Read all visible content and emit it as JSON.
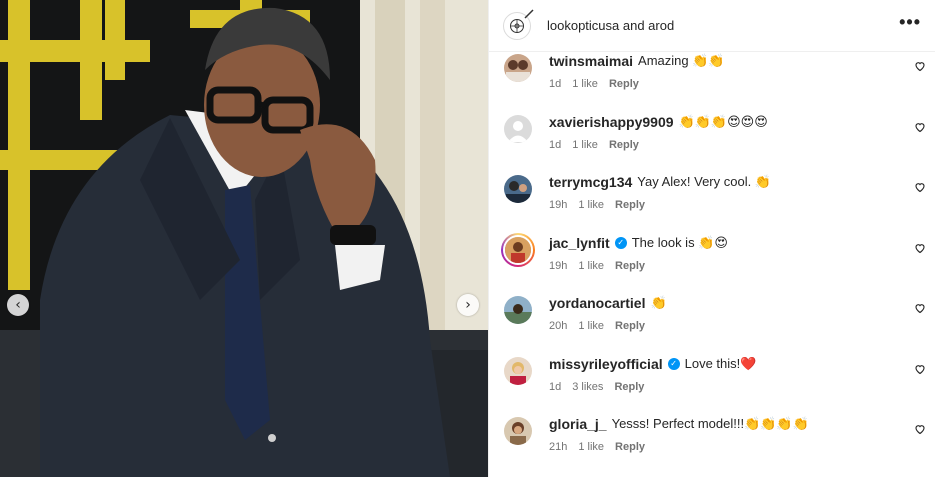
{
  "post": {
    "header_title": "lookopticusa and arod",
    "more_label": "•••",
    "prev_label": "‹",
    "next_label": "›"
  },
  "icons": {
    "more": "more-options-icon",
    "heart": "heart-icon",
    "verified": "verified-badge-icon",
    "prev": "chevron-left-icon",
    "next": "chevron-right-icon"
  },
  "colors": {
    "verified": "#0095f6",
    "meta_text": "#737373",
    "text": "#262626"
  },
  "comments": [
    {
      "user": "twinsmaimai",
      "verified": false,
      "text": "Amazing 👏👏",
      "time": "1d",
      "likes": "1 like",
      "reply": "Reply"
    },
    {
      "user": "xavierishappy9909",
      "verified": false,
      "text": "👏👏👏😍😍😍",
      "time": "1d",
      "likes": "1 like",
      "reply": "Reply"
    },
    {
      "user": "terrymcg134",
      "verified": false,
      "text": "Yay Alex! Very cool. 👏",
      "time": "19h",
      "likes": "1 like",
      "reply": "Reply"
    },
    {
      "user": "jac_lynfit",
      "verified": true,
      "text": "The look is 👏😍",
      "time": "19h",
      "likes": "1 like",
      "reply": "Reply"
    },
    {
      "user": "yordanocartiel",
      "verified": false,
      "text": "👏",
      "time": "20h",
      "likes": "1 like",
      "reply": "Reply"
    },
    {
      "user": "missyrileyofficial",
      "verified": true,
      "text": "Love this!❤️",
      "time": "1d",
      "likes": "3 likes",
      "reply": "Reply"
    },
    {
      "user": "gloria_j_",
      "verified": false,
      "text": "Yesss! Perfect model!!!👏👏👏👏",
      "time": "21h",
      "likes": "1 like",
      "reply": "Reply"
    }
  ]
}
